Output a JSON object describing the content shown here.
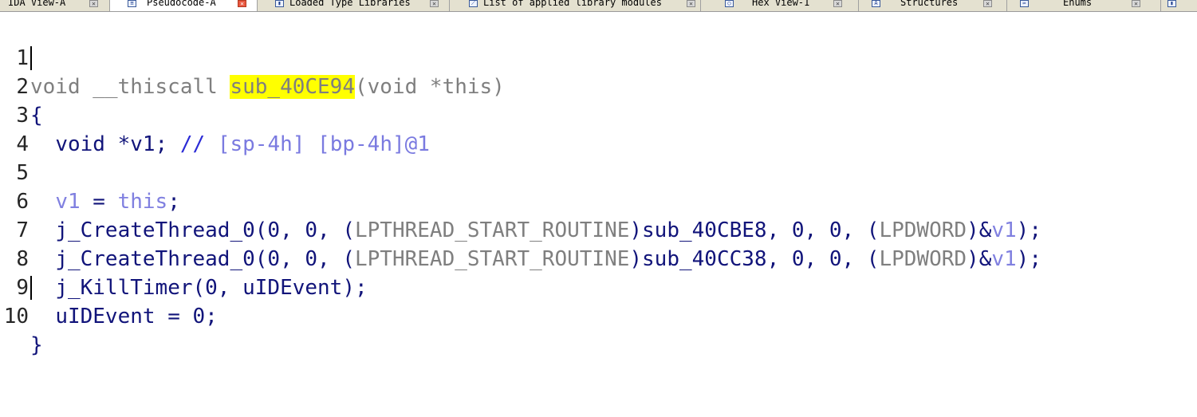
{
  "tabs": [
    {
      "label": "IDA View-A",
      "icon": "ida-view-icon",
      "active": false
    },
    {
      "label": "Pseudocode-A",
      "icon": "pseudocode-icon",
      "active": true
    },
    {
      "label": "Loaded Type Libraries",
      "icon": "type-library-icon",
      "active": false
    },
    {
      "label": "List of applied library modules",
      "icon": "library-modules-icon",
      "active": false
    },
    {
      "label": "Hex View-1",
      "icon": "hex-view-icon",
      "active": false
    },
    {
      "label": "Structures",
      "icon": "structures-icon",
      "active": false
    },
    {
      "label": "Enums",
      "icon": "enums-icon",
      "active": false
    }
  ],
  "code": {
    "line_numbers": [
      "1",
      "2",
      "3",
      "4",
      "5",
      "6",
      "7",
      "8",
      "9",
      "10"
    ],
    "l1": {
      "kw": "void __thiscall ",
      "func": "sub_40CE94",
      "rest": "(void *this)"
    },
    "l2": {
      "text": "{"
    },
    "l3": {
      "decl": "void *v1; ",
      "comment": "// ",
      "comment_rest": "[sp-4h] [bp-4h]@1"
    },
    "l5": {
      "lhs": "v1",
      "op": " = ",
      "rhs": "this",
      "end": ";"
    },
    "l6": {
      "call": "j_CreateThread_0",
      "a": "(0, 0, (",
      "cast": "LPTHREAD_START_ROUTINE",
      "b": ")",
      "fn": "sub_40CBE8",
      "c": ", 0, 0, (",
      "cast2": "LPDWORD",
      "d": ")&",
      "v": "v1",
      "e": ");"
    },
    "l7": {
      "call": "j_CreateThread_0",
      "a": "(0, 0, (",
      "cast": "LPTHREAD_START_ROUTINE",
      "b": ")",
      "fn": "sub_40CC38",
      "c": ", 0, 0, (",
      "cast2": "LPDWORD",
      "d": ")&",
      "v": "v1",
      "e": ");"
    },
    "l8": {
      "text": "j_KillTimer(0, uIDEvent);"
    },
    "l9": {
      "text": "uIDEvent = 0;"
    },
    "l10": {
      "text": "}"
    }
  }
}
